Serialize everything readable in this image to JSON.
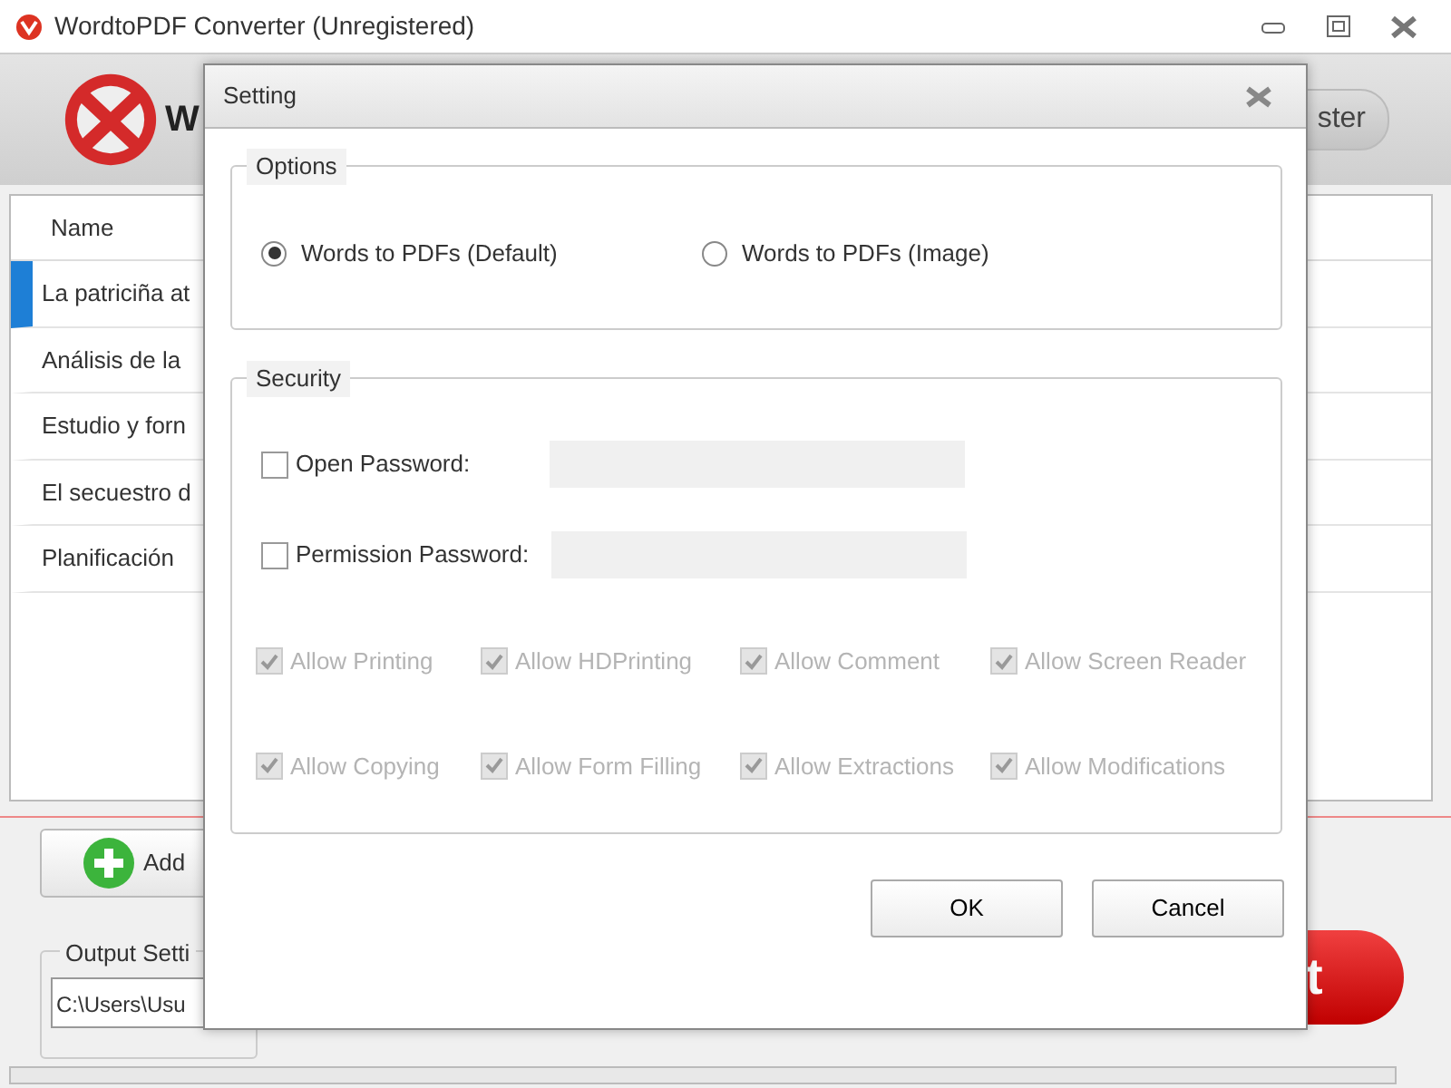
{
  "window": {
    "title": "WordtoPDF Converter (Unregistered)"
  },
  "header": {
    "title": "W",
    "register_button": "ster"
  },
  "file_list": {
    "columns": [
      "Name"
    ],
    "rows": [
      {
        "name": "La patriciña at",
        "selected": true
      },
      {
        "name": "Análisis de la",
        "selected": false
      },
      {
        "name": "Estudio y forn",
        "selected": false
      },
      {
        "name": "El secuestro d",
        "selected": false
      },
      {
        "name": "Planificación",
        "selected": false
      }
    ]
  },
  "add_button": "Add",
  "output_settings": {
    "label": "Output Setti",
    "path": "C:\\Users\\Usu"
  },
  "convert_button": "t",
  "progress": {
    "level": 0
  },
  "dialog": {
    "title": "Setting",
    "options": {
      "label": "Options",
      "choices": [
        {
          "label": "Words to PDFs (Default)",
          "selected": true
        },
        {
          "label": "Words to PDFs (Image)",
          "selected": false
        }
      ]
    },
    "security": {
      "label": "Security",
      "passwords": [
        {
          "label": "Open Password:",
          "checked": false
        },
        {
          "label": "Permission Password:",
          "checked": false
        }
      ],
      "permissions": [
        {
          "label": "Allow Printing",
          "checked": true,
          "disabled": true
        },
        {
          "label": "Allow HDPrinting",
          "checked": true,
          "disabled": true
        },
        {
          "label": "Allow Comment",
          "checked": true,
          "disabled": true
        },
        {
          "label": "Allow Screen Reader",
          "checked": true,
          "disabled": true
        },
        {
          "label": "Allow Copying",
          "checked": true,
          "disabled": true
        },
        {
          "label": "Allow Form Filling",
          "checked": true,
          "disabled": true
        },
        {
          "label": "Allow Extractions",
          "checked": true,
          "disabled": true
        },
        {
          "label": "Allow Modifications",
          "checked": true,
          "disabled": true
        }
      ]
    },
    "buttons": [
      "OK",
      "Cancel"
    ]
  }
}
